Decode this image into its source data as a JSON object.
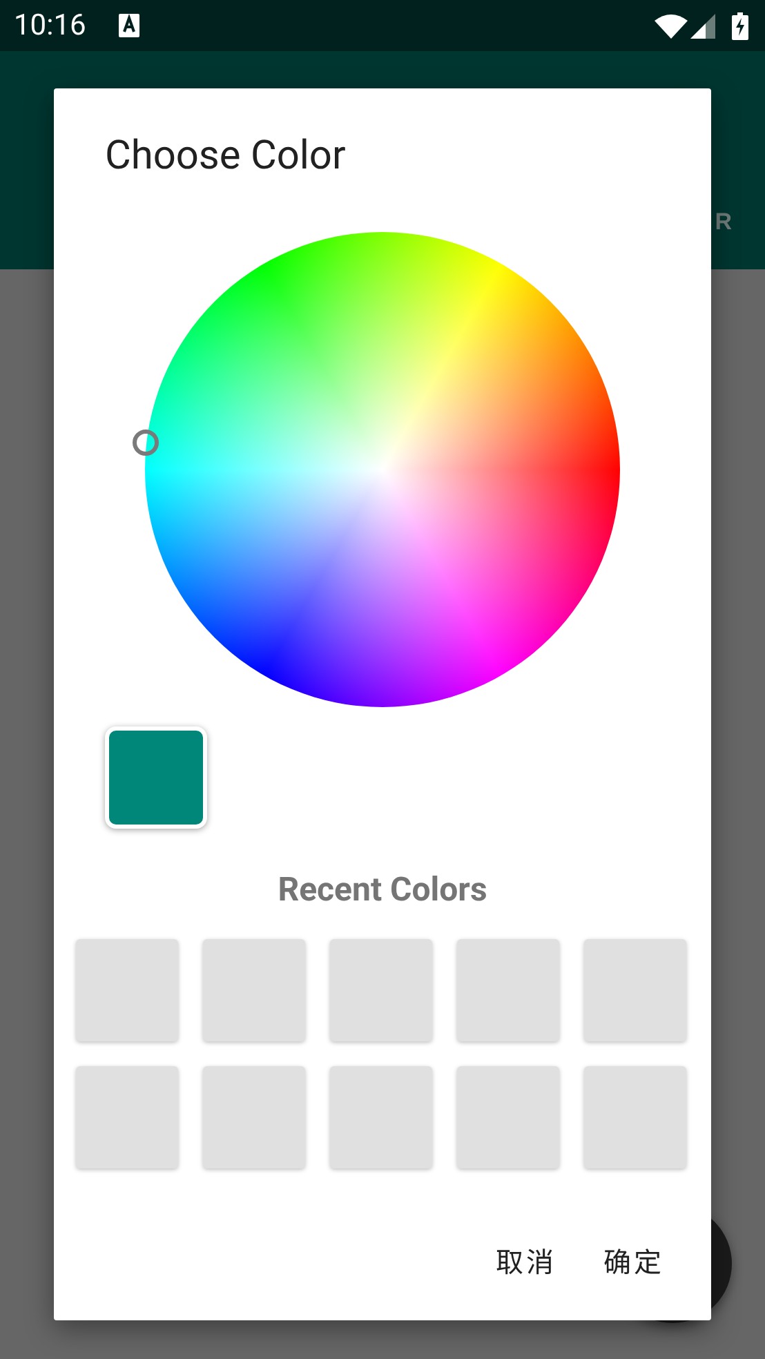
{
  "status_bar": {
    "time": "10:16"
  },
  "app_bar": {
    "tab": "R"
  },
  "dialog": {
    "title": "Choose Color",
    "selected_color": {
      "color": "#00877a"
    },
    "recent_title": "Recent Colors",
    "recent_colors": [
      {
        "color": "#e0e0e0"
      },
      {
        "color": "#e0e0e0"
      },
      {
        "color": "#e0e0e0"
      },
      {
        "color": "#e0e0e0"
      },
      {
        "color": "#e0e0e0"
      },
      {
        "color": "#e0e0e0"
      },
      {
        "color": "#e0e0e0"
      },
      {
        "color": "#e0e0e0"
      },
      {
        "color": "#e0e0e0"
      },
      {
        "color": "#e0e0e0"
      }
    ],
    "buttons": [
      "取消",
      "确定"
    ]
  }
}
